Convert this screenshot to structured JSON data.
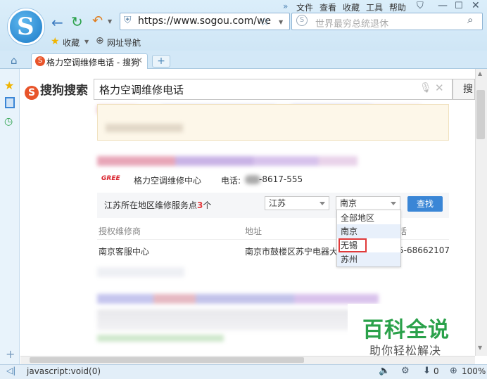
{
  "browser": {
    "menu": [
      "文件",
      "查看",
      "收藏",
      "工具",
      "帮助"
    ],
    "address": "https://www.sogou.com/we",
    "search_placeholder": "世界最穷总统退休",
    "favorites_label": "收藏",
    "nav_label": "网址导航",
    "tab_title": "格力空调维修电话 - 搜狗",
    "status_url": "javascript:void(0)",
    "zoom": "100%",
    "download_count": "0"
  },
  "sogou": {
    "logo_text": "搜狗搜索",
    "query": "格力空调维修电话",
    "search_btn": "搜"
  },
  "result": {
    "brand": "GREE",
    "center_name": "格力空调维修中心",
    "phone_label": "电话:",
    "phone": "-8617-555",
    "filter_prefix": "江苏所在地区维修服务点",
    "filter_count": "3",
    "filter_suffix": "个",
    "province": "江苏",
    "city": "南京",
    "find_btn": "查找",
    "city_options": [
      "全部地区",
      "南京",
      "无锡",
      "苏州"
    ],
    "columns": [
      "授权维修商",
      "地址",
      "话"
    ],
    "rows": [
      {
        "dealer": "南京客服中心",
        "address": "南京市鼓楼区苏宁电器大",
        "phone": "5-68662107"
      }
    ]
  },
  "watermark": {
    "title": "百科全说",
    "subtitle": "助你轻松解决"
  }
}
